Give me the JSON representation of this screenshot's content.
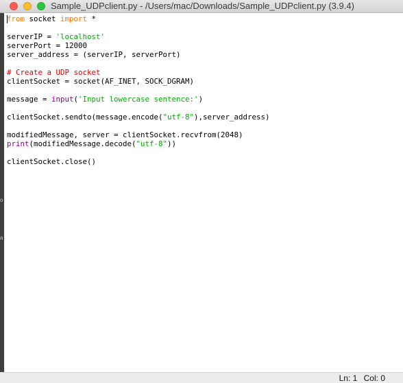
{
  "window": {
    "title": "Sample_UDPclient.py - /Users/mac/Downloads/Sample_UDPclient.py (3.9.4)"
  },
  "colors": {
    "keyword": "#ff7700",
    "string": "#00aa00",
    "comment": "#dd0000",
    "builtin": "#900090",
    "text": "#000000"
  },
  "editor": {
    "lines": [
      [
        {
          "t": "from",
          "c": "kw"
        },
        {
          "t": " socket "
        },
        {
          "t": "import",
          "c": "kw"
        },
        {
          "t": " *"
        }
      ],
      [],
      [
        {
          "t": "serverIP = "
        },
        {
          "t": "'localhost'",
          "c": "str"
        }
      ],
      [
        {
          "t": "serverPort = 12000"
        }
      ],
      [
        {
          "t": "server_address = (serverIP, serverPort)"
        }
      ],
      [],
      [
        {
          "t": "# Create a UDP socket",
          "c": "cmt"
        }
      ],
      [
        {
          "t": "clientSocket = socket(AF_INET, SOCK_DGRAM)"
        }
      ],
      [],
      [
        {
          "t": "message = "
        },
        {
          "t": "input",
          "c": "bi"
        },
        {
          "t": "("
        },
        {
          "t": "'Input lowercase sentence:'",
          "c": "str"
        },
        {
          "t": ")"
        }
      ],
      [],
      [
        {
          "t": "clientSocket.sendto(message.encode("
        },
        {
          "t": "\"utf-8\"",
          "c": "str"
        },
        {
          "t": "),server_address)"
        }
      ],
      [],
      [
        {
          "t": "modifiedMessage, server = clientSocket.recvfrom(2048)"
        }
      ],
      [
        {
          "t": "print",
          "c": "bi"
        },
        {
          "t": "(modifiedMessage.decode("
        },
        {
          "t": "\"utf-8\"",
          "c": "str"
        },
        {
          "t": "))"
        }
      ],
      [],
      [
        {
          "t": "clientSocket.close()"
        }
      ]
    ]
  },
  "status": {
    "line": "Ln: 1",
    "column": "Col: 0"
  },
  "background_fragments": [
    "o",
    "a"
  ]
}
